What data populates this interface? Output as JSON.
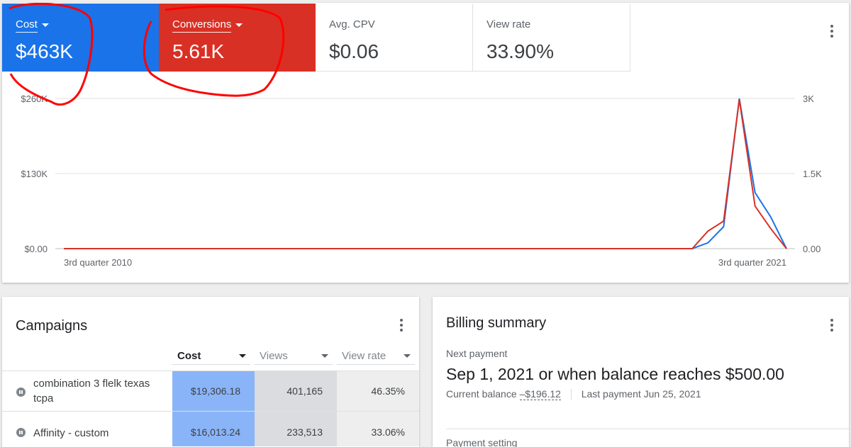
{
  "overview": {
    "metrics": [
      {
        "label": "Cost",
        "value": "$463K",
        "color": "#1a73e8",
        "dropdown": true
      },
      {
        "label": "Conversions",
        "value": "5.61K",
        "color": "#d93025",
        "dropdown": true
      },
      {
        "label": "Avg. CPV",
        "value": "$0.06",
        "dropdown": false
      },
      {
        "label": "View rate",
        "value": "33.90%",
        "dropdown": false
      }
    ],
    "menu_icon": "more-vert-icon"
  },
  "chart_data": {
    "type": "line",
    "x_tick_labels": [
      "3rd quarter 2010",
      "3rd quarter 2021"
    ],
    "y_left_ticks": [
      "$0.00",
      "$130K",
      "$260K"
    ],
    "y_left_values": [
      0,
      130000,
      260000
    ],
    "y_right_ticks": [
      "0.00",
      "1.5K",
      "3K"
    ],
    "y_right_values": [
      0,
      1500,
      3000
    ],
    "grid": true,
    "x_index_range": [
      0,
      44
    ],
    "series": [
      {
        "name": "Cost",
        "color": "#1a73e8",
        "axis": "left",
        "points": [
          [
            0,
            0
          ],
          [
            40,
            0
          ],
          [
            41,
            10000
          ],
          [
            42,
            38000
          ],
          [
            43,
            260000
          ],
          [
            44,
            97000
          ],
          [
            45,
            55000
          ],
          [
            46,
            0
          ]
        ]
      },
      {
        "name": "Conversions",
        "color": "#d93025",
        "axis": "right",
        "points": [
          [
            0,
            0
          ],
          [
            40,
            0
          ],
          [
            41,
            350
          ],
          [
            42,
            550
          ],
          [
            43,
            2980
          ],
          [
            44,
            850
          ],
          [
            45,
            400
          ],
          [
            46,
            0
          ]
        ]
      }
    ]
  },
  "campaigns": {
    "title": "Campaigns",
    "columns": [
      "Cost",
      "Views",
      "View rate"
    ],
    "rows": [
      {
        "name": "combination 3 flelk texas tcpa",
        "cost": "$19,306.18",
        "views": "401,165",
        "view_rate": "46.35%"
      },
      {
        "name": "Affinity - custom",
        "cost": "$16,013.24",
        "views": "233,513",
        "view_rate": "33.06%"
      }
    ]
  },
  "billing": {
    "title": "Billing summary",
    "next_payment_label": "Next payment",
    "next_payment_value": "Sep 1, 2021 or when balance reaches $500.00",
    "current_balance_label": "Current balance",
    "current_balance_value": "–$196.12",
    "last_payment": "Last payment Jun 25, 2021",
    "payment_setting_label": "Payment setting"
  },
  "annotation_color": "#ff0000"
}
